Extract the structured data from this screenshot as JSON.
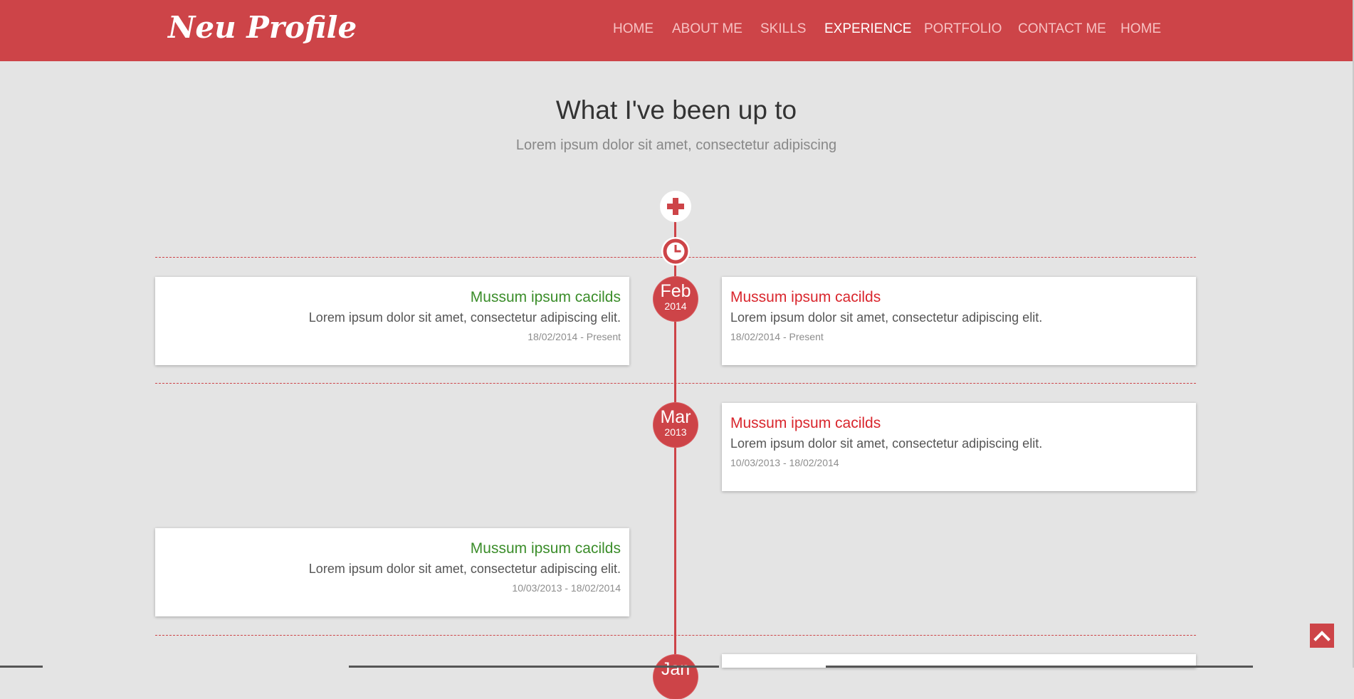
{
  "header": {
    "brand": "Neu Profile",
    "nav": [
      {
        "label": "HOME",
        "active": false
      },
      {
        "label": "ABOUT ME",
        "active": false
      },
      {
        "label": "SKILLS",
        "active": false
      },
      {
        "label": "EXPERIENCE",
        "active": true
      },
      {
        "label": "PORTFOLIO",
        "active": false
      },
      {
        "label": "CONTACT ME",
        "active": false
      },
      {
        "label": "HOME",
        "active": false
      }
    ]
  },
  "section": {
    "title": "What I've been up to",
    "subtitle": "Lorem ipsum dolor sit amet, consectetur adipiscing"
  },
  "timeline": {
    "badges": [
      {
        "month": "Feb",
        "year": "2014"
      },
      {
        "month": "Mar",
        "year": "2013"
      },
      {
        "month": "Jan",
        "year": ""
      }
    ],
    "entries": [
      {
        "title": "Mussum ipsum cacilds",
        "description": "Lorem ipsum dolor sit amet, consectetur adipiscing elit.",
        "dates": "18/02/2014 - Present"
      },
      {
        "title": "Mussum ipsum cacilds",
        "description": "Lorem ipsum dolor sit amet, consectetur adipiscing elit.",
        "dates": "18/02/2014 - Present"
      },
      {
        "title": "Mussum ipsum cacilds",
        "description": "Lorem ipsum dolor sit amet, consectetur adipiscing elit.",
        "dates": "10/03/2013 - 18/02/2014"
      },
      {
        "title": "Mussum ipsum cacilds",
        "description": "Lorem ipsum dolor sit amet, consectetur adipiscing elit.",
        "dates": "10/03/2013 - 18/02/2014"
      }
    ]
  },
  "icons": {
    "expand": "plus-icon",
    "timeline_start": "clock-icon",
    "back_to_top": "chevron-up-icon"
  },
  "colors": {
    "primary": "#cd4448",
    "background": "#e4e4e4",
    "left_title": "#3b8d2a",
    "right_title": "#d9262d"
  }
}
